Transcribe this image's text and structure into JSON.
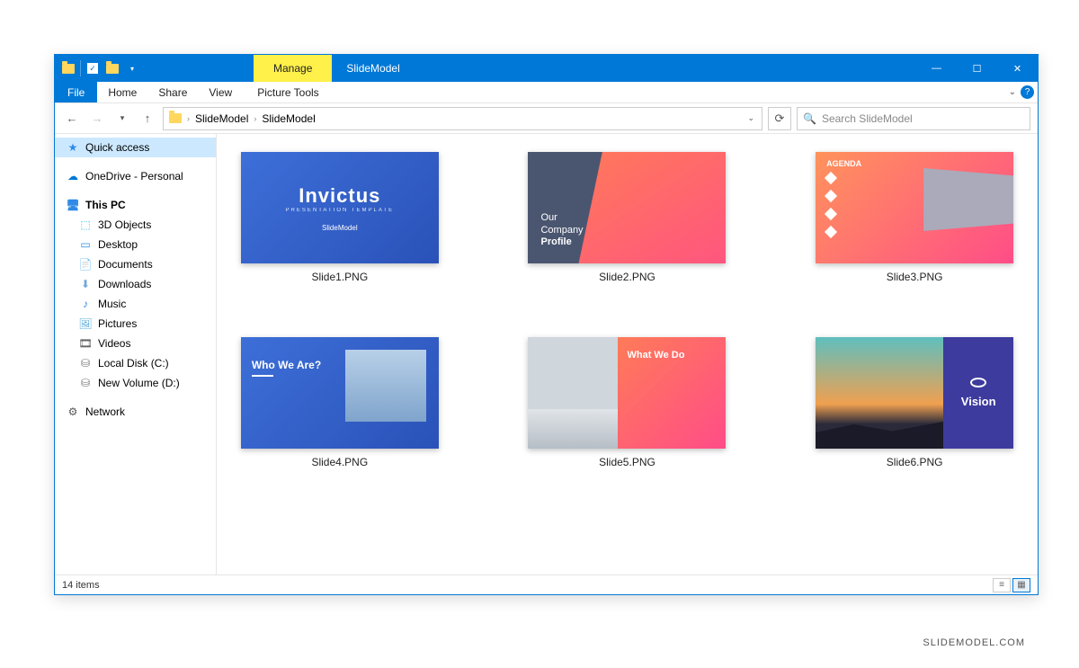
{
  "titlebar": {
    "manage": "Manage",
    "title": "SlideModel"
  },
  "window_controls": {
    "min": "—",
    "max": "☐",
    "close": "✕"
  },
  "ribbon": {
    "file": "File",
    "tabs": [
      "Home",
      "Share",
      "View"
    ],
    "context": "Picture Tools"
  },
  "address": {
    "segments": [
      "SlideModel",
      "SlideModel"
    ]
  },
  "search": {
    "placeholder": "Search SlideModel"
  },
  "nav": {
    "quick_access": "Quick access",
    "onedrive": "OneDrive - Personal",
    "this_pc": "This PC",
    "items": [
      "3D Objects",
      "Desktop",
      "Documents",
      "Downloads",
      "Music",
      "Pictures",
      "Videos",
      "Local Disk (C:)",
      "New Volume (D:)"
    ],
    "network": "Network"
  },
  "files": [
    {
      "name": "Slide1.PNG",
      "preview": {
        "title": "Invictus",
        "subtitle": "PRESENTATION TEMPLATE",
        "logo": "SlideModel"
      }
    },
    {
      "name": "Slide2.PNG",
      "preview": {
        "line1": "Our",
        "line2": "Company",
        "line3": "Profile"
      }
    },
    {
      "name": "Slide3.PNG",
      "preview": {
        "header": "AGENDA"
      }
    },
    {
      "name": "Slide4.PNG",
      "preview": {
        "title": "Who We Are?"
      }
    },
    {
      "name": "Slide5.PNG",
      "preview": {
        "title": "What We Do"
      }
    },
    {
      "name": "Slide6.PNG",
      "preview": {
        "title": "Vision"
      }
    }
  ],
  "status": {
    "count": "14 items"
  },
  "attribution": "SLIDEMODEL.COM"
}
